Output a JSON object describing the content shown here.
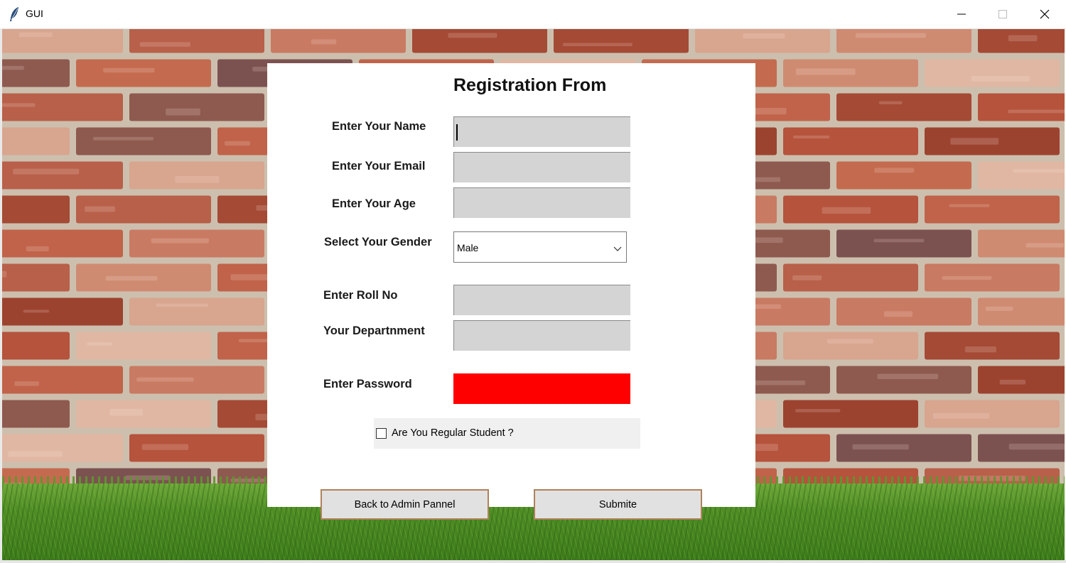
{
  "window": {
    "title": "GUI",
    "icons": {
      "app": "feather-icon",
      "minimize": "minimize-icon",
      "maximize": "maximize-icon",
      "close": "close-icon"
    }
  },
  "form": {
    "title": "Registration From",
    "name_label": "Enter Your Name",
    "email_label": "Enter Your Email",
    "age_label": "Enter Your Age",
    "gender_label": "Select Your Gender",
    "gender_value": "Male",
    "rollno_label": "Enter Roll No",
    "department_label": "Your Departnment",
    "password_label": "Enter Password",
    "regular_label": "Are You Regular Student ?",
    "back_button": "Back to Admin Pannel",
    "submit_button": "Submite"
  },
  "colors": {
    "entry_bg": "#d4d4d4",
    "password_bg": "#ff0000",
    "button_border": "#b0825c",
    "button_bg": "#e1e1e1"
  }
}
